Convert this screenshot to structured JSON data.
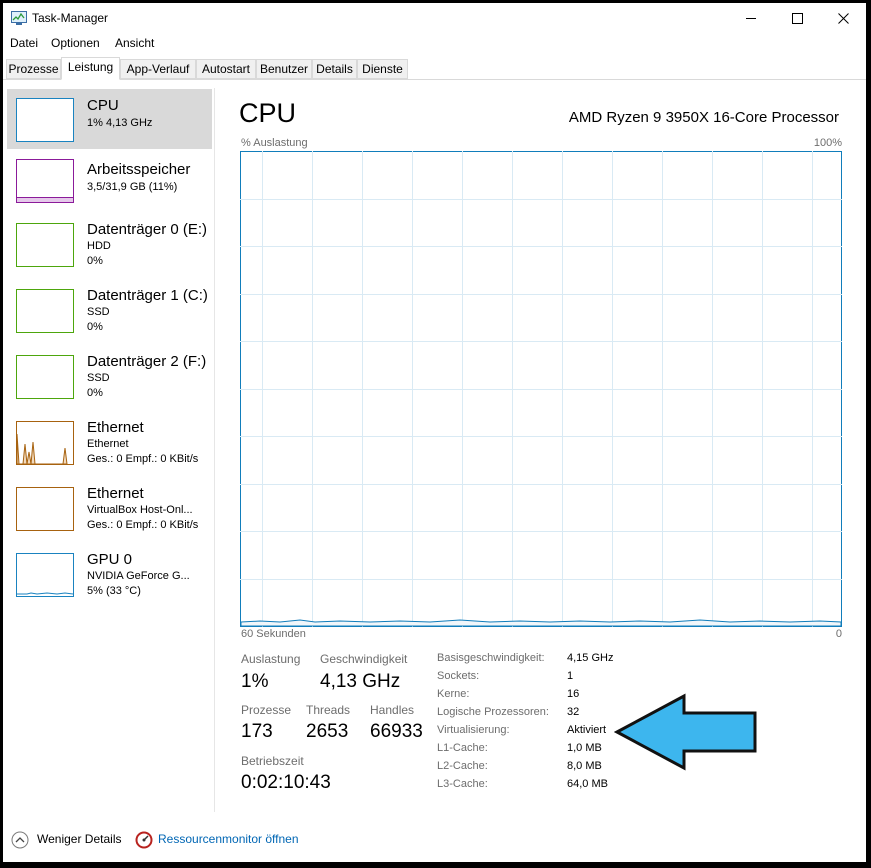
{
  "window": {
    "title": "Task-Manager",
    "icons": [
      "taskmanager-icon",
      "minimize-icon",
      "maximize-icon",
      "close-icon"
    ]
  },
  "menu": [
    "Datei",
    "Optionen",
    "Ansicht"
  ],
  "tabs": [
    "Prozesse",
    "Leistung",
    "App-Verlauf",
    "Autostart",
    "Benutzer",
    "Details",
    "Dienste"
  ],
  "active_tab": "Leistung",
  "sidebar": [
    {
      "title": "CPU",
      "lines": [
        "1% 4,13 GHz"
      ],
      "color": "#1a83c0"
    },
    {
      "title": "Arbeitsspeicher",
      "lines": [
        "3,5/31,9 GB (11%)"
      ],
      "color": "#8b1a9a"
    },
    {
      "title": "Datenträger 0 (E:)",
      "lines": [
        "HDD",
        "0%"
      ],
      "color": "#4da60c"
    },
    {
      "title": "Datenträger 1 (C:)",
      "lines": [
        "SSD",
        "0%"
      ],
      "color": "#4da60c"
    },
    {
      "title": "Datenträger 2 (F:)",
      "lines": [
        "SSD",
        "0%"
      ],
      "color": "#4da60c"
    },
    {
      "title": "Ethernet",
      "lines": [
        "Ethernet",
        "Ges.: 0 Empf.: 0 KBit/s"
      ],
      "color": "#a7620f"
    },
    {
      "title": "Ethernet",
      "lines": [
        "VirtualBox Host-Onl...",
        "Ges.: 0 Empf.: 0 KBit/s"
      ],
      "color": "#a7620f"
    },
    {
      "title": "GPU 0",
      "lines": [
        "NVIDIA GeForce G...",
        "5% (33 °C)"
      ],
      "color": "#1a83c0"
    }
  ],
  "main": {
    "title": "CPU",
    "model": "AMD Ryzen 9 3950X 16-Core Processor",
    "graph": {
      "label_top_left": "% Auslastung",
      "label_top_right": "100%",
      "label_bottom_left": "60 Sekunden",
      "label_bottom_right": "0",
      "color": "#117dbb"
    }
  },
  "stats": {
    "auslastung": {
      "label": "Auslastung",
      "value": "1%"
    },
    "geschwindigkeit": {
      "label": "Geschwindigkeit",
      "value": "4,13 GHz"
    },
    "prozesse": {
      "label": "Prozesse",
      "value": "173"
    },
    "threads": {
      "label": "Threads",
      "value": "2653"
    },
    "handles": {
      "label": "Handles",
      "value": "66933"
    },
    "betriebszeit": {
      "label": "Betriebszeit",
      "value": "0:02:10:43"
    }
  },
  "info": [
    {
      "label": "Basisgeschwindigkeit:",
      "value": "4,15 GHz"
    },
    {
      "label": "Sockets:",
      "value": "1"
    },
    {
      "label": "Kerne:",
      "value": "16"
    },
    {
      "label": "Logische Prozessoren:",
      "value": "32"
    },
    {
      "label": "Virtualisierung:",
      "value": "Aktiviert"
    },
    {
      "label": "L1-Cache:",
      "value": "1,0 MB"
    },
    {
      "label": "L2-Cache:",
      "value": "8,0 MB"
    },
    {
      "label": "L3-Cache:",
      "value": "64,0 MB"
    }
  ],
  "footer": {
    "less_details": "Weniger Details",
    "resource_monitor": "Ressourcenmonitor öffnen"
  },
  "annotation": {
    "color": "#3db6ee",
    "icon": "arrow-left-icon"
  }
}
